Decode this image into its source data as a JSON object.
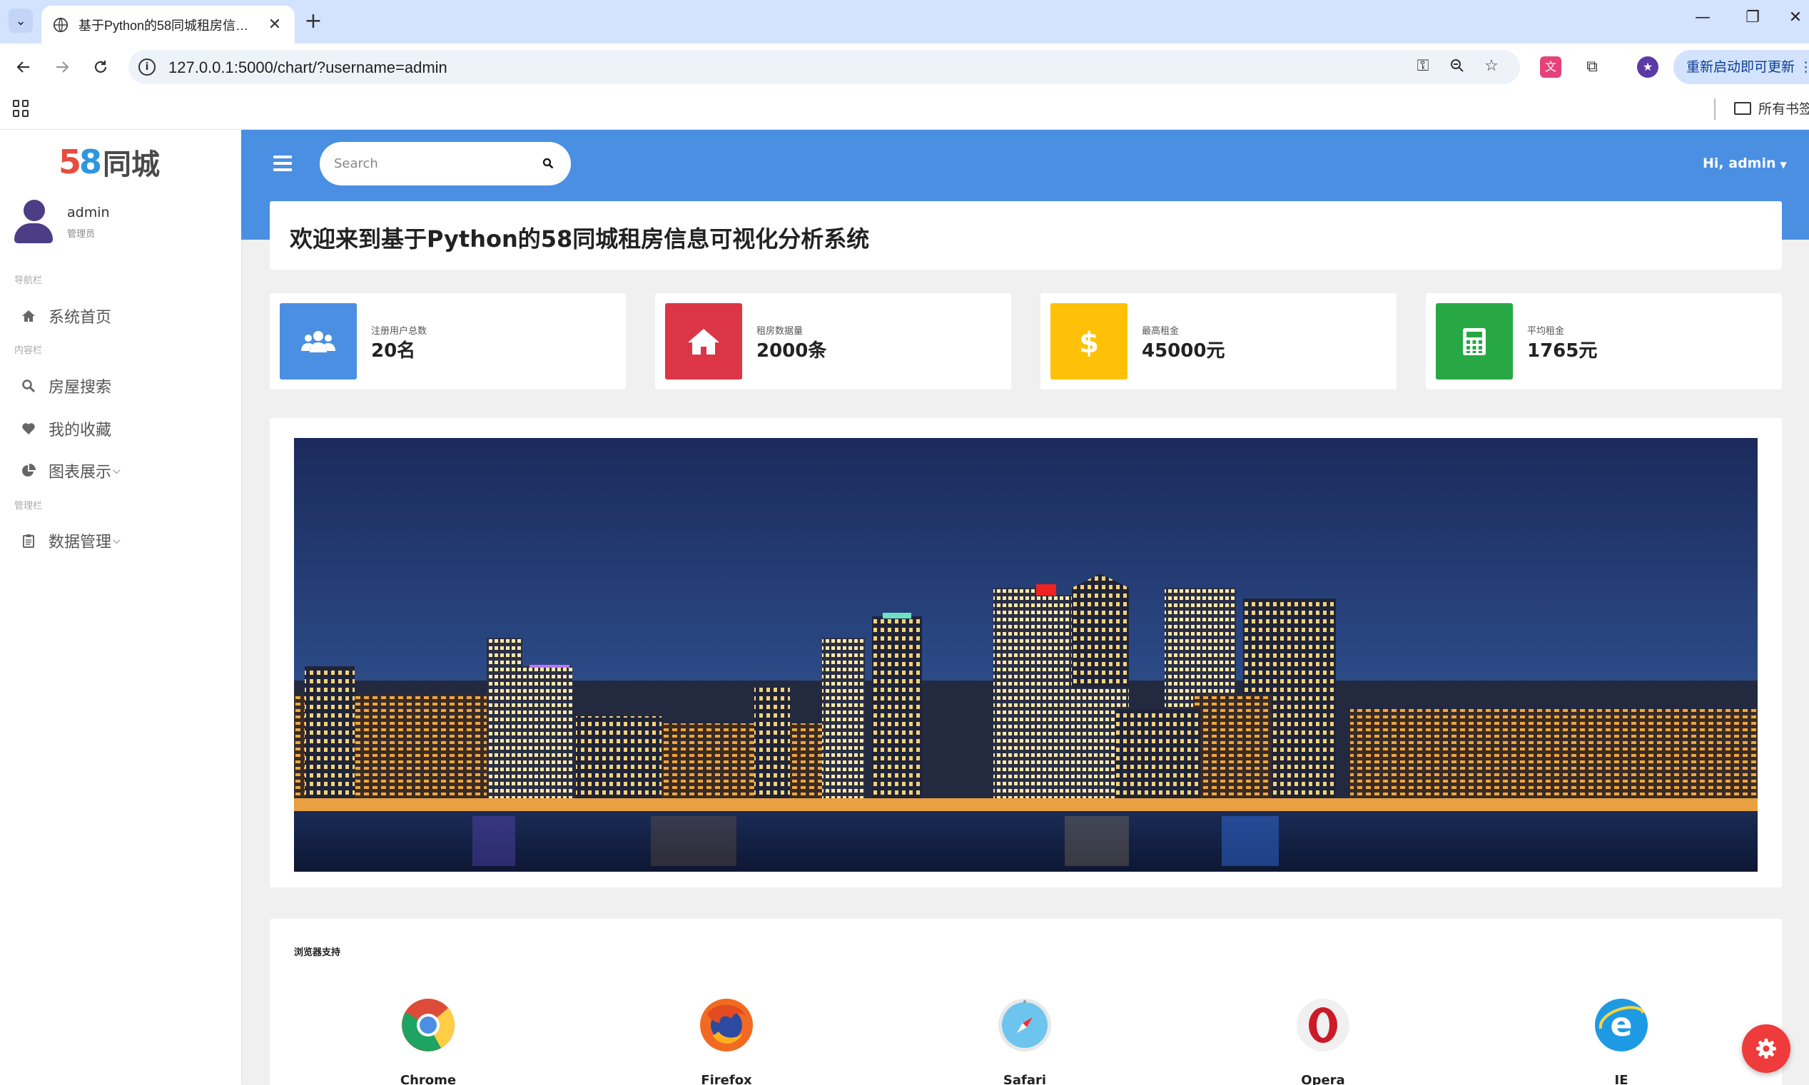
{
  "browser": {
    "tab_title": "基于Python的58同城租房信息可视化分析系统",
    "url": "127.0.0.1:5000/chart/?username=admin",
    "update_label": "重新启动即可更新",
    "bookmarks_label": "所有书签"
  },
  "sidebar": {
    "logo_digit1": "5",
    "logo_digit2": "8",
    "logo_text": "同城",
    "user_name": "admin",
    "user_role": "管理员",
    "section_nav": "导航栏",
    "section_content": "内容栏",
    "section_admin": "管理栏",
    "items": [
      {
        "label": "系统首页",
        "icon": "home-icon"
      },
      {
        "label": "房屋搜索",
        "icon": "search-icon"
      },
      {
        "label": "我的收藏",
        "icon": "heart-icon"
      },
      {
        "label": "图表展示",
        "icon": "pie-chart-icon"
      },
      {
        "label": "数据管理",
        "icon": "clipboard-icon"
      }
    ]
  },
  "header": {
    "search_placeholder": "Search",
    "greeting": "Hi, admin"
  },
  "welcome": {
    "title": "欢迎来到基于Python的58同城租房信息可视化分析系统"
  },
  "stats": [
    {
      "label": "注册用户总数",
      "value": "20名",
      "color": "#4a8fe2",
      "icon": "users-icon"
    },
    {
      "label": "租房数据量",
      "value": "2000条",
      "color": "#dc3545",
      "icon": "house-icon"
    },
    {
      "label": "最高租金",
      "value": "45000元",
      "color": "#ffc107",
      "icon": "dollar-icon"
    },
    {
      "label": "平均租金",
      "value": "1765元",
      "color": "#28a745",
      "icon": "calculator-icon"
    }
  ],
  "browsers": {
    "title": "浏览器支持",
    "items": [
      {
        "name": "Chrome",
        "icon": "chrome-icon"
      },
      {
        "name": "Firefox",
        "icon": "firefox-icon"
      },
      {
        "name": "Safari",
        "icon": "safari-icon"
      },
      {
        "name": "Opera",
        "icon": "opera-icon"
      },
      {
        "name": "IE",
        "icon": "ie-icon"
      }
    ]
  },
  "colors": {
    "accent": "#4a8fe2",
    "fab": "#ef3b3b"
  }
}
